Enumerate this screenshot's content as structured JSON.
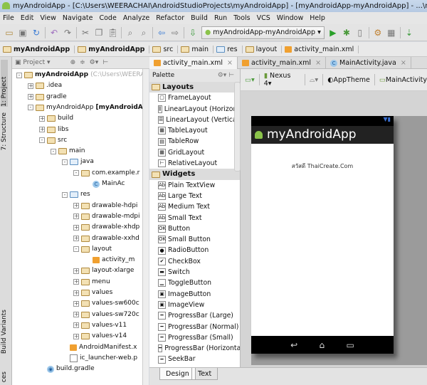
{
  "window": {
    "title": "myAndroidApp - [C:\\Users\\WEERACHAI\\AndroidStudioProjects\\myAndroidApp] - [myAndroidApp-myAndroidApp] - ...\\myAndroidApp\\src\\main\\res\\layout\\activity_main.xml"
  },
  "menu": [
    "File",
    "Edit",
    "View",
    "Navigate",
    "Code",
    "Analyze",
    "Refactor",
    "Build",
    "Run",
    "Tools",
    "VCS",
    "Window",
    "Help"
  ],
  "toolbar": {
    "run_config": "myAndroidApp-myAndroidApp"
  },
  "breadcrumbs": [
    "myAndroidApp",
    "myAndroidApp",
    "src",
    "main",
    "res",
    "layout",
    "activity_main.xml"
  ],
  "side_tabs": {
    "project": "1: Project",
    "structure": "7: Structure",
    "build_variants": "Build Variants",
    "favorites": "ces"
  },
  "project_panel": {
    "view": "Project"
  },
  "tree": [
    {
      "label": "myAndroidApp",
      "extra": " (C:\\Users\\WEERA",
      "depth": 0,
      "exp": "-",
      "bold": true,
      "icon": "module"
    },
    {
      "label": ".idea",
      "depth": 1,
      "exp": "+",
      "icon": "folder"
    },
    {
      "label": "gradle",
      "depth": 1,
      "exp": "+",
      "icon": "folder"
    },
    {
      "label": "myAndroidApp",
      "extra": " [myAndroidA",
      "depth": 1,
      "exp": "-",
      "icon": "module"
    },
    {
      "label": "build",
      "depth": 2,
      "exp": "+",
      "icon": "folder"
    },
    {
      "label": "libs",
      "depth": 2,
      "exp": "+",
      "icon": "folder"
    },
    {
      "label": "src",
      "depth": 2,
      "exp": "-",
      "icon": "folder"
    },
    {
      "label": "main",
      "depth": 3,
      "exp": "-",
      "icon": "folder"
    },
    {
      "label": "java",
      "depth": 4,
      "exp": "-",
      "icon": "blue"
    },
    {
      "label": "com.example.r",
      "depth": 5,
      "exp": "-",
      "icon": "package"
    },
    {
      "label": "MainAc",
      "depth": 6,
      "exp": "",
      "icon": "class"
    },
    {
      "label": "res",
      "depth": 4,
      "exp": "-",
      "icon": "blue"
    },
    {
      "label": "drawable-hdpi",
      "depth": 5,
      "exp": "+",
      "icon": "package"
    },
    {
      "label": "drawable-mdpi",
      "depth": 5,
      "exp": "+",
      "icon": "package"
    },
    {
      "label": "drawable-xhdp",
      "depth": 5,
      "exp": "+",
      "icon": "package"
    },
    {
      "label": "drawable-xxhd",
      "depth": 5,
      "exp": "+",
      "icon": "package"
    },
    {
      "label": "layout",
      "depth": 5,
      "exp": "-",
      "icon": "package"
    },
    {
      "label": "activity_m",
      "depth": 6,
      "exp": "",
      "icon": "xml"
    },
    {
      "label": "layout-xlarge",
      "depth": 5,
      "exp": "+",
      "icon": "package"
    },
    {
      "label": "menu",
      "depth": 5,
      "exp": "+",
      "icon": "package"
    },
    {
      "label": "values",
      "depth": 5,
      "exp": "+",
      "icon": "package"
    },
    {
      "label": "values-sw600c",
      "depth": 5,
      "exp": "+",
      "icon": "package"
    },
    {
      "label": "values-sw720c",
      "depth": 5,
      "exp": "+",
      "icon": "package"
    },
    {
      "label": "values-v11",
      "depth": 5,
      "exp": "+",
      "icon": "package"
    },
    {
      "label": "values-v14",
      "depth": 5,
      "exp": "+",
      "icon": "package"
    },
    {
      "label": "AndroidManifest.x",
      "depth": 4,
      "exp": "",
      "icon": "xml"
    },
    {
      "label": "ic_launcher-web.p",
      "depth": 4,
      "exp": "",
      "icon": "file"
    },
    {
      "label": "build.gradle",
      "depth": 2,
      "exp": "",
      "icon": "gradle"
    }
  ],
  "editor_tabs": [
    {
      "label": "activity_main.xml",
      "icon": "xml",
      "active": true
    },
    {
      "label": "activity_main.xml",
      "icon": "xml"
    },
    {
      "label": "MainActivity.java",
      "icon": "class"
    }
  ],
  "palette": {
    "title": "Palette",
    "groups": [
      {
        "name": "Layouts",
        "items": [
          [
            "FrameLayout",
            "▢"
          ],
          [
            "LinearLayout (Horizont",
            "⫼"
          ],
          [
            "LinearLayout (Vertical)",
            "☰"
          ],
          [
            "TableLayout",
            "▦"
          ],
          [
            "TableRow",
            "▤"
          ],
          [
            "GridLayout",
            "▦"
          ],
          [
            "RelativeLayout",
            "⊢"
          ]
        ]
      },
      {
        "name": "Widgets",
        "items": [
          [
            "Plain TextView",
            "Ab"
          ],
          [
            "Large Text",
            "Ab"
          ],
          [
            "Medium Text",
            "Ab"
          ],
          [
            "Small Text",
            "Ab"
          ],
          [
            "Button",
            "OK"
          ],
          [
            "Small Button",
            "OK"
          ],
          [
            "RadioButton",
            "●"
          ],
          [
            "CheckBox",
            "✔"
          ],
          [
            "Switch",
            "▬"
          ],
          [
            "ToggleButton",
            "▁"
          ],
          [
            "ImageButton",
            "▣"
          ],
          [
            "ImageView",
            "▣"
          ],
          [
            "ProgressBar (Large)",
            "━"
          ],
          [
            "ProgressBar (Normal)",
            "━"
          ],
          [
            "ProgressBar (Small)",
            "━"
          ],
          [
            "ProgressBar (Horizonta",
            "━"
          ],
          [
            "SeekBar",
            "━"
          ]
        ]
      }
    ]
  },
  "design_tabs": {
    "design": "Design",
    "text": "Text"
  },
  "editor_toolbar": {
    "device": "Nexus 4",
    "theme": "AppTheme",
    "activity": "MainActivity"
  },
  "preview": {
    "app_title": "myAndroidApp",
    "text": "สวัสดี ThaiCreate.Com"
  }
}
